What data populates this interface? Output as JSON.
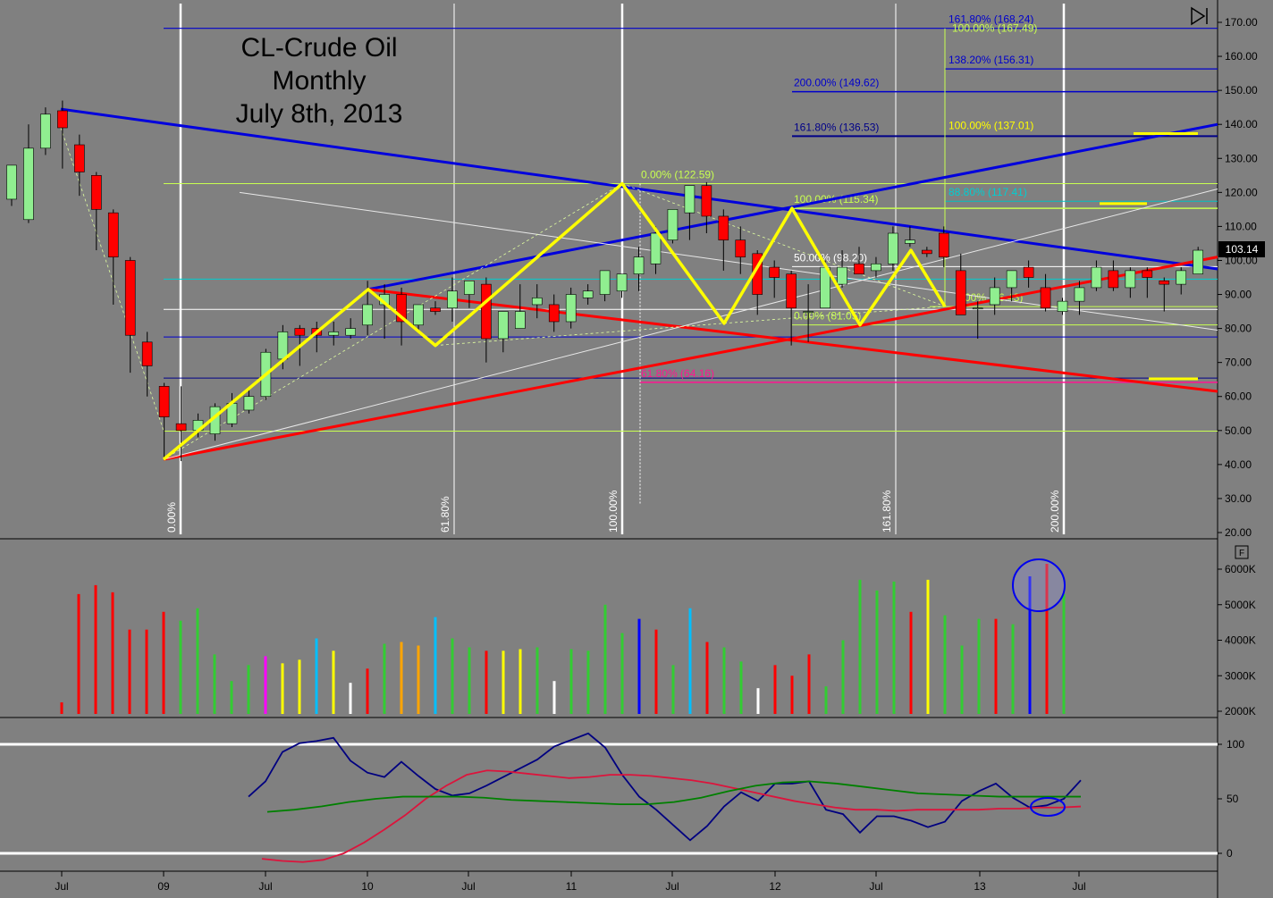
{
  "title": {
    "line1": "CL-Crude Oil",
    "line2": "Monthly",
    "line3": "July 8th, 2013"
  },
  "colors": {
    "bg": "#808080",
    "bull": "#90ee90",
    "bear": "#ff0000",
    "yellow": "#ffff00",
    "blue": "#0000ee",
    "red": "#ff0000",
    "navy": "#000080",
    "green": "#008000",
    "crimson": "#dc143c",
    "lime": "#c8ff50"
  },
  "price_badge": "103.14",
  "x_labels": [
    "Jul",
    "09",
    "Jul",
    "10",
    "Jul",
    "11",
    "Jul",
    "12",
    "Jul",
    "13",
    "Jul"
  ],
  "price_ticks": [
    "170.00",
    "160.00",
    "150.00",
    "140.00",
    "130.00",
    "120.00",
    "110.00",
    "100.00",
    "90.00",
    "80.00",
    "70.00",
    "60.00",
    "50.00",
    "40.00",
    "30.00",
    "20.00"
  ],
  "volume_ticks": [
    "6000K",
    "5000K",
    "4000K",
    "3000K",
    "2000K"
  ],
  "osc_ticks": [
    "100",
    "50",
    "0"
  ],
  "time_fibs": [
    "0.00%",
    "61.80%",
    "100.00%",
    "161.80%",
    "200.00%"
  ],
  "fib_labels": {
    "f1": "161.80% (168.24)",
    "f1b": "100.00% (167.49)",
    "f2": "138.20% (156.31)",
    "f3": "200.00% (149.62)",
    "f4": "161.80% (136.53)",
    "f5": "100.00% (137.01)",
    "f6": "0.00% (122.59)",
    "f7": "100.00% (115.34)",
    "f8": "88.80% (117.41)",
    "f9": "50.00% (98.20)",
    "f10": "0.00% (86.43)",
    "f11": "0.00% (81.05)",
    "f12": "61.80% (64.16)"
  },
  "icons": {
    "panel_toggle": "play-end-icon",
    "f_button": "F"
  },
  "chart_data": {
    "type": "candlestick",
    "title": "CL-Crude Oil Monthly July 8th, 2013",
    "ylim": [
      20,
      170
    ],
    "candles": [
      {
        "o": 118,
        "h": 124,
        "l": 116,
        "c": 128
      },
      {
        "o": 112,
        "h": 140,
        "l": 111,
        "c": 133
      },
      {
        "o": 133,
        "h": 145,
        "l": 131,
        "c": 143
      },
      {
        "o": 144,
        "h": 147,
        "l": 127,
        "c": 139
      },
      {
        "o": 134,
        "h": 137,
        "l": 119,
        "c": 126
      },
      {
        "o": 125,
        "h": 126,
        "l": 103,
        "c": 115
      },
      {
        "o": 114,
        "h": 115,
        "l": 87,
        "c": 101
      },
      {
        "o": 100,
        "h": 101,
        "l": 67,
        "c": 78
      },
      {
        "o": 76,
        "h": 79,
        "l": 60,
        "c": 69
      },
      {
        "o": 63,
        "h": 64,
        "l": 42,
        "c": 54
      },
      {
        "o": 52,
        "h": 63,
        "l": 41,
        "c": 50
      },
      {
        "o": 50,
        "h": 55,
        "l": 48,
        "c": 53
      },
      {
        "o": 49,
        "h": 58,
        "l": 47,
        "c": 57
      },
      {
        "o": 52,
        "h": 61,
        "l": 51,
        "c": 58
      },
      {
        "o": 56,
        "h": 62,
        "l": 55,
        "c": 60
      },
      {
        "o": 60,
        "h": 74,
        "l": 59,
        "c": 73
      },
      {
        "o": 71,
        "h": 81,
        "l": 68,
        "c": 79
      },
      {
        "o": 80,
        "h": 81,
        "l": 69,
        "c": 78
      },
      {
        "o": 80,
        "h": 82,
        "l": 73,
        "c": 78
      },
      {
        "o": 78,
        "h": 82,
        "l": 75,
        "c": 79
      },
      {
        "o": 78,
        "h": 83,
        "l": 77,
        "c": 80
      },
      {
        "o": 81,
        "h": 94,
        "l": 78,
        "c": 87
      },
      {
        "o": 87,
        "h": 93,
        "l": 77,
        "c": 90
      },
      {
        "o": 90,
        "h": 92,
        "l": 75,
        "c": 82
      },
      {
        "o": 81,
        "h": 87,
        "l": 79,
        "c": 87
      },
      {
        "o": 86,
        "h": 88,
        "l": 84,
        "c": 85
      },
      {
        "o": 86,
        "h": 95,
        "l": 82,
        "c": 91
      },
      {
        "o": 90,
        "h": 93,
        "l": 86,
        "c": 94
      },
      {
        "o": 93,
        "h": 95,
        "l": 70,
        "c": 77
      },
      {
        "o": 77,
        "h": 85,
        "l": 73,
        "c": 85
      },
      {
        "o": 80,
        "h": 93,
        "l": 80,
        "c": 85
      },
      {
        "o": 87,
        "h": 93,
        "l": 83,
        "c": 89
      },
      {
        "o": 87,
        "h": 90,
        "l": 79,
        "c": 82
      },
      {
        "o": 82,
        "h": 92,
        "l": 80,
        "c": 90
      },
      {
        "o": 89,
        "h": 93,
        "l": 87,
        "c": 91
      },
      {
        "o": 90,
        "h": 97,
        "l": 88,
        "c": 97
      },
      {
        "o": 91,
        "h": 95,
        "l": 89,
        "c": 96
      },
      {
        "o": 96,
        "h": 104,
        "l": 91,
        "c": 101
      },
      {
        "o": 99,
        "h": 110,
        "l": 96,
        "c": 108
      },
      {
        "o": 106,
        "h": 114,
        "l": 105,
        "c": 115
      },
      {
        "o": 114,
        "h": 122,
        "l": 106,
        "c": 122
      },
      {
        "o": 122,
        "h": 123,
        "l": 108,
        "c": 113
      },
      {
        "o": 113,
        "h": 115,
        "l": 97,
        "c": 106
      },
      {
        "o": 106,
        "h": 110,
        "l": 96,
        "c": 101
      },
      {
        "o": 102,
        "h": 103,
        "l": 84,
        "c": 90
      },
      {
        "o": 98,
        "h": 100,
        "l": 89,
        "c": 95
      },
      {
        "o": 96,
        "h": 97,
        "l": 75,
        "c": 86
      },
      {
        "o": 85,
        "h": 93,
        "l": 76,
        "c": 85
      },
      {
        "o": 86,
        "h": 100,
        "l": 86,
        "c": 98
      },
      {
        "o": 93,
        "h": 103,
        "l": 92,
        "c": 98
      },
      {
        "o": 99,
        "h": 104,
        "l": 96,
        "c": 96
      },
      {
        "o": 97,
        "h": 101,
        "l": 95,
        "c": 99
      },
      {
        "o": 99,
        "h": 110,
        "l": 97,
        "c": 108
      },
      {
        "o": 105,
        "h": 110,
        "l": 104,
        "c": 106
      },
      {
        "o": 103,
        "h": 104,
        "l": 101,
        "c": 102
      },
      {
        "o": 108,
        "h": 110,
        "l": 98,
        "c": 101
      },
      {
        "o": 97,
        "h": 102,
        "l": 89,
        "c": 84
      },
      {
        "o": 86,
        "h": 88,
        "l": 77,
        "c": 86
      },
      {
        "o": 87,
        "h": 95,
        "l": 84,
        "c": 92
      },
      {
        "o": 92,
        "h": 97,
        "l": 88,
        "c": 97
      },
      {
        "o": 98,
        "h": 100,
        "l": 92,
        "c": 95
      },
      {
        "o": 92,
        "h": 96,
        "l": 85,
        "c": 86
      },
      {
        "o": 85,
        "h": 89,
        "l": 84,
        "c": 88
      },
      {
        "o": 88,
        "h": 94,
        "l": 84,
        "c": 92
      },
      {
        "o": 92,
        "h": 100,
        "l": 91,
        "c": 98
      },
      {
        "o": 97,
        "h": 100,
        "l": 91,
        "c": 92
      },
      {
        "o": 92,
        "h": 98,
        "l": 89,
        "c": 97
      },
      {
        "o": 97,
        "h": 98,
        "l": 89,
        "c": 95
      },
      {
        "o": 94,
        "h": 95,
        "l": 85,
        "c": 93
      },
      {
        "o": 93,
        "h": 98,
        "l": 90,
        "c": 97
      },
      {
        "o": 96,
        "h": 104,
        "l": 96,
        "c": 103
      }
    ],
    "volume_ylim": [
      2000,
      6500
    ],
    "volume": [
      {
        "v": 2250,
        "c": "#ff0000"
      },
      {
        "v": 5300,
        "c": "#ff0000"
      },
      {
        "v": 5550,
        "c": "#ff0000"
      },
      {
        "v": 5350,
        "c": "#ff0000"
      },
      {
        "v": 4300,
        "c": "#ff0000"
      },
      {
        "v": 4300,
        "c": "#ff0000"
      },
      {
        "v": 4800,
        "c": "#ff0000"
      },
      {
        "v": 4550,
        "c": "#32cd32"
      },
      {
        "v": 4900,
        "c": "#32cd32"
      },
      {
        "v": 3600,
        "c": "#32cd32"
      },
      {
        "v": 2850,
        "c": "#32cd32"
      },
      {
        "v": 3300,
        "c": "#32cd32"
      },
      {
        "v": 3550,
        "c": "#ff00ff"
      },
      {
        "v": 3350,
        "c": "#ffff00"
      },
      {
        "v": 3450,
        "c": "#ffff00"
      },
      {
        "v": 4050,
        "c": "#00bfff"
      },
      {
        "v": 3700,
        "c": "#ffff00"
      },
      {
        "v": 2800,
        "c": "#ffffff"
      },
      {
        "v": 3200,
        "c": "#ff0000"
      },
      {
        "v": 3900,
        "c": "#32cd32"
      },
      {
        "v": 3950,
        "c": "#ffa500"
      },
      {
        "v": 3850,
        "c": "#ffa500"
      },
      {
        "v": 4650,
        "c": "#00bfff"
      },
      {
        "v": 4050,
        "c": "#32cd32"
      },
      {
        "v": 3800,
        "c": "#32cd32"
      },
      {
        "v": 3700,
        "c": "#ff0000"
      },
      {
        "v": 3700,
        "c": "#ffff00"
      },
      {
        "v": 3750,
        "c": "#ffff00"
      },
      {
        "v": 3800,
        "c": "#32cd32"
      },
      {
        "v": 2850,
        "c": "#ffffff"
      },
      {
        "v": 3750,
        "c": "#32cd32"
      },
      {
        "v": 3700,
        "c": "#32cd32"
      },
      {
        "v": 5000,
        "c": "#32cd32"
      },
      {
        "v": 4200,
        "c": "#32cd32"
      },
      {
        "v": 4600,
        "c": "#0000ff"
      },
      {
        "v": 4300,
        "c": "#ff0000"
      },
      {
        "v": 3300,
        "c": "#32cd32"
      },
      {
        "v": 4900,
        "c": "#00bfff"
      },
      {
        "v": 3950,
        "c": "#ff0000"
      },
      {
        "v": 3800,
        "c": "#32cd32"
      },
      {
        "v": 3400,
        "c": "#32cd32"
      },
      {
        "v": 2650,
        "c": "#ffffff"
      },
      {
        "v": 3300,
        "c": "#ff0000"
      },
      {
        "v": 3000,
        "c": "#ff0000"
      },
      {
        "v": 3600,
        "c": "#ff0000"
      },
      {
        "v": 2700,
        "c": "#32cd32"
      },
      {
        "v": 4000,
        "c": "#32cd32"
      },
      {
        "v": 5700,
        "c": "#32cd32"
      },
      {
        "v": 5400,
        "c": "#32cd32"
      },
      {
        "v": 5650,
        "c": "#32cd32"
      },
      {
        "v": 4800,
        "c": "#ff0000"
      },
      {
        "v": 5700,
        "c": "#ffff00"
      },
      {
        "v": 4700,
        "c": "#32cd32"
      },
      {
        "v": 3850,
        "c": "#32cd32"
      },
      {
        "v": 4600,
        "c": "#32cd32"
      },
      {
        "v": 4600,
        "c": "#ff0000"
      },
      {
        "v": 4450,
        "c": "#32cd32"
      },
      {
        "v": 5800,
        "c": "#0000ff"
      },
      {
        "v": 6150,
        "c": "#ff0000"
      },
      {
        "v": 5300,
        "c": "#32cd32"
      }
    ],
    "osc_ylim": [
      -10,
      110
    ],
    "oscillator": {
      "k": [
        52,
        66,
        93,
        101,
        103,
        106,
        85,
        74,
        70,
        84,
        71,
        59,
        53,
        55,
        62,
        70,
        78,
        86,
        98,
        104,
        110,
        97,
        72,
        52,
        40,
        26,
        12,
        25,
        43,
        56,
        48,
        64,
        64,
        66,
        40,
        36,
        19,
        34,
        34,
        30,
        24,
        29,
        48,
        57,
        64,
        51,
        42,
        44,
        50,
        67
      ],
      "d": [
        -5,
        -7,
        -8,
        -6,
        0,
        10,
        22,
        35,
        50,
        62,
        72,
        76,
        75,
        73,
        71,
        69,
        70,
        72,
        72,
        71,
        69,
        67,
        64,
        60,
        56,
        52,
        48,
        45,
        42,
        40,
        40,
        39,
        40,
        40,
        40,
        40,
        41,
        41,
        42,
        42,
        43
      ],
      "slow": [
        38,
        40,
        43,
        47,
        50,
        52,
        52,
        52,
        51,
        49,
        48,
        47,
        46,
        45,
        45,
        47,
        51,
        57,
        62,
        65,
        66,
        64,
        61,
        58,
        55,
        54,
        53,
        52,
        52,
        52,
        52
      ]
    },
    "fib_price_lines": [
      168.24,
      156.31,
      149.62,
      136.53,
      122.59,
      115.34,
      98.2,
      86.43,
      81.05,
      64.16
    ]
  }
}
